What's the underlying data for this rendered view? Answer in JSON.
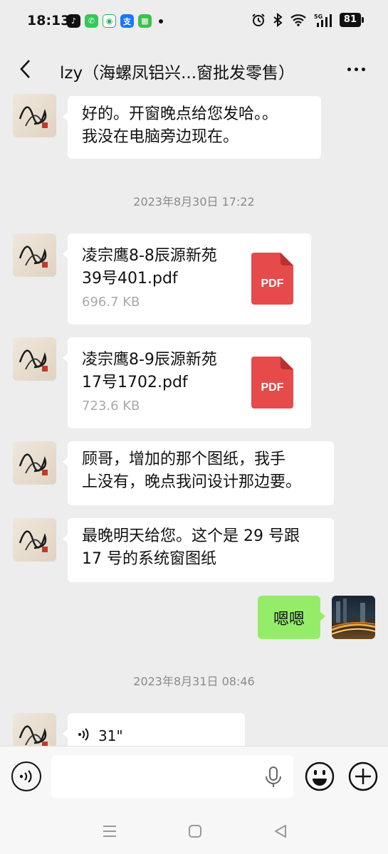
{
  "status_bar": {
    "time": "18:13",
    "battery": "81",
    "notif_icon_names": [
      "tiktok-icon",
      "phone-icon",
      "app-icon",
      "alipay-icon",
      "chat-app-icon"
    ],
    "sys_icon_names": [
      "alarm-icon",
      "bluetooth-icon",
      "wifi-icon",
      "signal-5g-icon",
      "battery-icon"
    ]
  },
  "header": {
    "title": "lzy（海螺凤铝兴...窗批发零售）",
    "back_icon": "chevron-left-icon",
    "more_icon": "more-icon"
  },
  "messages": [
    {
      "type": "text",
      "sender": "contact",
      "text_lines": [
        "好的。开窗晚点给您发哈。。",
        "我没在电脑旁边现在。"
      ]
    },
    {
      "type": "timestamp",
      "text": "2023年8月30日 17:22"
    },
    {
      "type": "file",
      "sender": "contact",
      "name_lines": [
        "凌宗鹰8-8辰源新苑",
        "39号401.pdf"
      ],
      "size": "696.7 KB",
      "badge": "PDF"
    },
    {
      "type": "file",
      "sender": "contact",
      "name_lines": [
        "凌宗鹰8-9辰源新苑",
        "17号1702.pdf"
      ],
      "size": "723.6 KB",
      "badge": "PDF"
    },
    {
      "type": "text",
      "sender": "contact",
      "text_lines": [
        "顾哥，增加的那个图纸，我手",
        "上没有，晚点我问设计那边要。"
      ]
    },
    {
      "type": "text",
      "sender": "contact",
      "text_lines": [
        "最晚明天给您。这个是 29 号跟",
        "17 号的系统窗图纸"
      ]
    },
    {
      "type": "text",
      "sender": "me",
      "text": "嗯嗯"
    },
    {
      "type": "timestamp",
      "text": "2023年8月31日 08:46"
    },
    {
      "type": "voice",
      "sender": "contact",
      "duration": "31\""
    }
  ],
  "input_bar": {
    "placeholder": "",
    "icons": [
      "voice-mode-icon",
      "microphone-icon",
      "emoji-icon",
      "plus-icon"
    ]
  },
  "nav_bar": {
    "icons": [
      "menu-icon",
      "home-icon",
      "back-icon"
    ]
  },
  "colors": {
    "background": "#ededed",
    "my_bubble": "#95ec69",
    "their_bubble": "#ffffff",
    "pdf_red": "#e64a4a",
    "timestamp": "#8a8a8a"
  }
}
